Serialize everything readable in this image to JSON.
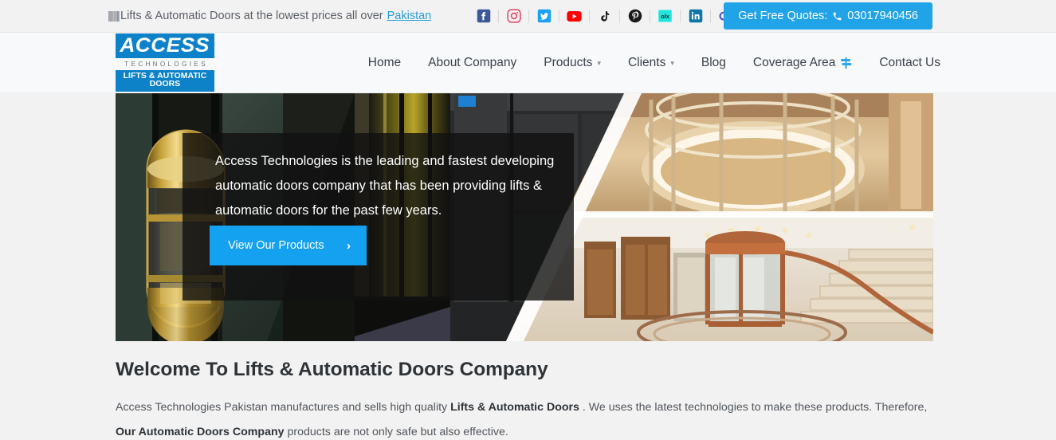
{
  "topbar": {
    "tagline_text": "Lifts & Automatic Doors at the lowest prices all over ",
    "tagline_link": "Pakistan",
    "social": [
      {
        "name": "facebook",
        "label": "Facebook"
      },
      {
        "name": "instagram",
        "label": "Instagram"
      },
      {
        "name": "twitter",
        "label": "Twitter"
      },
      {
        "name": "youtube",
        "label": "YouTube"
      },
      {
        "name": "tiktok",
        "label": "TikTok"
      },
      {
        "name": "pinterest",
        "label": "Pinterest"
      },
      {
        "name": "olx",
        "label": "OLX"
      },
      {
        "name": "linkedin",
        "label": "LinkedIn"
      },
      {
        "name": "googleplus",
        "label": "Google Plus"
      }
    ],
    "quote_label": "Get Free Quotes:",
    "quote_phone": "03017940456"
  },
  "header": {
    "logo": {
      "word": "ACCESS",
      "sub": "TECHNOLOGIES",
      "tagline": "LIFTS & AUTOMATIC DOORS"
    },
    "nav": [
      {
        "label": "Home",
        "caret": false,
        "icon": false
      },
      {
        "label": "About Company",
        "caret": false,
        "icon": false
      },
      {
        "label": "Products",
        "caret": true,
        "icon": false
      },
      {
        "label": "Clients",
        "caret": true,
        "icon": false
      },
      {
        "label": "Blog",
        "caret": false,
        "icon": false
      },
      {
        "label": "Coverage Area",
        "caret": false,
        "icon": true
      },
      {
        "label": "Contact Us",
        "caret": false,
        "icon": false
      }
    ]
  },
  "hero": {
    "text": "Access Technologies is the leading and fastest developing automatic doors company that has been providing lifts & automatic doors for the past few years.",
    "cta_label": "View Our Products",
    "cta_arrow": "›"
  },
  "welcome": {
    "heading": "Welcome To Lifts & Automatic Doors Company",
    "p_part1": "Access Technologies Pakistan manufactures and sells high quality ",
    "p_strong1": "Lifts & Automatic Doors",
    "p_part2": " . We uses the latest technologies to make these products. Therefore, ",
    "p_strong2": "Our Automatic Doors Company",
    "p_part3": " products are not only safe but also effective."
  },
  "colors": {
    "accent_blue": "#21a3e8",
    "cta_blue": "#14a1f0",
    "logo_blue": "#0e82c8",
    "topbar_bg": "#f2f2f2",
    "header_bg": "#f7f9fb",
    "link_blue": "#2a9fd6"
  }
}
